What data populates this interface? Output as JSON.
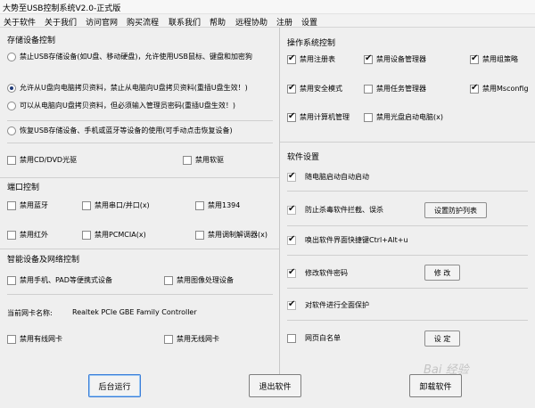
{
  "window": {
    "title": "大势至USB控制系统V2.0-正式版"
  },
  "menu": [
    "关于软件",
    "关于我们",
    "访问官网",
    "购买流程",
    "联系我们",
    "帮助",
    "远程协助",
    "注册",
    "设置"
  ],
  "storage": {
    "title": "存储设备控制",
    "options": [
      {
        "label": "禁止USB存储设备(如U盘、移动硬盘)，允许使用USB鼠标、键盘和加密狗",
        "selected": false
      },
      {
        "label": "允许从U盘向电脑拷贝资料，禁止从电脑向U盘拷贝资料(重插U盘生效！)",
        "selected": true
      },
      {
        "label": "可以从电脑向U盘拷贝资料，但必须输入管理员密码(重插U盘生效！)",
        "selected": false
      },
      {
        "label": "恢复USB存储设备、手机或蓝牙等设备的使用(可手动点击恢复设备)",
        "selected": false
      }
    ],
    "cd": {
      "label": "禁用CD/DVD光驱",
      "checked": false
    },
    "floppy": {
      "label": "禁用软驱",
      "checked": false
    }
  },
  "port": {
    "title": "端口控制",
    "items": [
      {
        "label": "禁用蓝牙",
        "checked": false
      },
      {
        "label": "禁用串口/并口(x)",
        "checked": false
      },
      {
        "label": "禁用1394",
        "checked": false
      },
      {
        "label": "禁用红外",
        "checked": false
      },
      {
        "label": "禁用PCMCIA(x)",
        "checked": false
      },
      {
        "label": "禁用调制解调器(x)",
        "checked": false
      }
    ]
  },
  "smart": {
    "title": "智能设备及网络控制",
    "phone": {
      "label": "禁用手机、PAD等便携式设备",
      "checked": false
    },
    "imaging": {
      "label": "禁用图像处理设备",
      "checked": false
    },
    "nic_label": "当前网卡名称:",
    "nic_value": "Realtek PCIe GBE Family Controller",
    "wired": {
      "label": "禁用有线网卡",
      "checked": false
    },
    "wireless": {
      "label": "禁用无线网卡",
      "checked": false
    }
  },
  "os": {
    "title": "操作系统控制",
    "items": [
      {
        "label": "禁用注册表",
        "checked": true
      },
      {
        "label": "禁用设备管理器",
        "checked": true
      },
      {
        "label": "禁用组策略",
        "checked": true
      },
      {
        "label": "禁用安全模式",
        "checked": true
      },
      {
        "label": "禁用任务管理器",
        "checked": false
      },
      {
        "label": "禁用Msconfig",
        "checked": true
      },
      {
        "label": "禁用计算机管理",
        "checked": true
      },
      {
        "label": "禁用光盘启动电脑(x)",
        "checked": false
      }
    ]
  },
  "software": {
    "title": "软件设置",
    "autostart": {
      "label": "随电脑启动自动启动",
      "checked": true
    },
    "antikill": {
      "label": "防止杀毒软件拦截、误杀",
      "checked": true,
      "button": "设置防护列表"
    },
    "hotkey": {
      "label": "唤出软件界面快捷键Ctrl+Alt+u",
      "checked": true
    },
    "password": {
      "label": "修改软件密码",
      "checked": true,
      "button": "修 改"
    },
    "protect": {
      "label": "对软件进行全面保护",
      "checked": true
    },
    "whitelist": {
      "label": "网页白名单",
      "checked": false,
      "button": "设 定"
    }
  },
  "footer": {
    "run_bg": "后台运行",
    "exit": "退出软件",
    "uninstall": "卸载软件",
    "watermark": "Bai 经验"
  },
  "colors": {
    "panel": "#efefef",
    "check_dim": "#a7a7a7",
    "focus_border": "#3b7ed9"
  }
}
